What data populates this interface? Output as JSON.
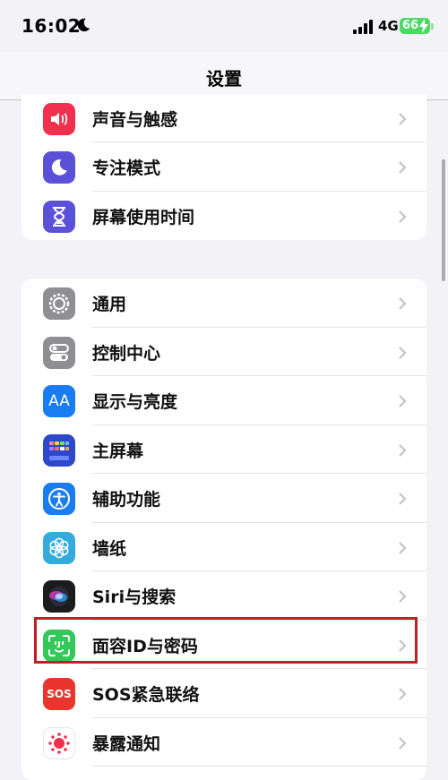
{
  "status_bar": {
    "time": "16:02",
    "network": "4G",
    "battery": "66"
  },
  "nav": {
    "title": "设置"
  },
  "groups": [
    {
      "items": [
        {
          "label": "声音与触感",
          "icon": "speaker-icon",
          "color": "#f2304d"
        },
        {
          "label": "专注模式",
          "icon": "moon-icon",
          "color": "#5b51d8"
        },
        {
          "label": "屏幕使用时间",
          "icon": "hourglass-icon",
          "color": "#5b51d8"
        }
      ]
    },
    {
      "items": [
        {
          "label": "通用",
          "icon": "gear-icon",
          "color": "#8e8e93"
        },
        {
          "label": "控制中心",
          "icon": "toggles-icon",
          "color": "#8e8e93"
        },
        {
          "label": "显示与亮度",
          "icon": "text-size-icon",
          "color": "#1a7cf2"
        },
        {
          "label": "主屏幕",
          "icon": "home-grid-icon",
          "color": "#2f47c9"
        },
        {
          "label": "辅助功能",
          "icon": "accessibility-icon",
          "color": "#1a7cf2"
        },
        {
          "label": "墙纸",
          "icon": "flower-icon",
          "color": "#35aadc"
        },
        {
          "label": "Siri与搜索",
          "icon": "siri-icon",
          "color": "#1c1c1e"
        },
        {
          "label": "面容ID与密码",
          "icon": "face-id-icon",
          "color": "#34c759"
        },
        {
          "label": "SOS紧急联络",
          "icon": "sos-icon",
          "color": "#e8352e",
          "icon_text": "SOS"
        },
        {
          "label": "暴露通知",
          "icon": "exposure-icon",
          "color": "#ffffff"
        }
      ]
    }
  ],
  "highlight_color": "#c31f28"
}
